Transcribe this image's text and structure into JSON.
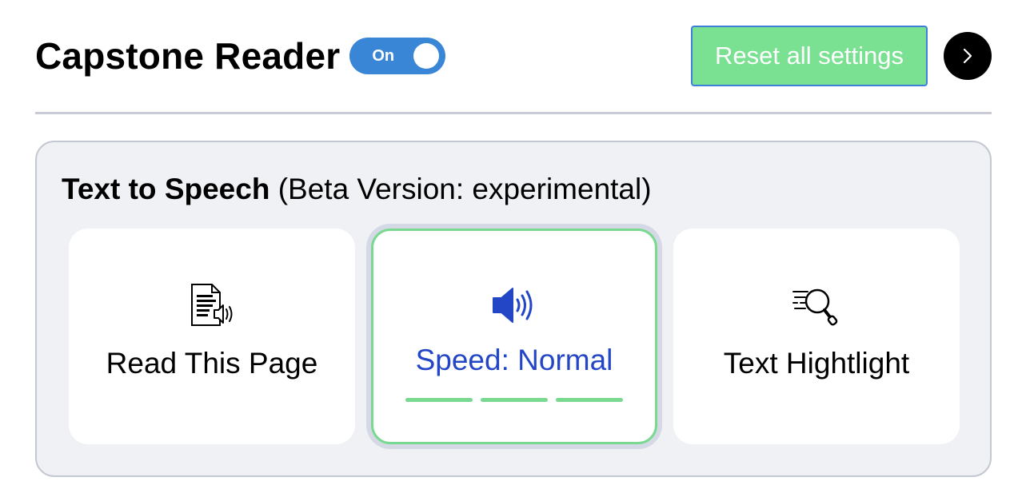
{
  "header": {
    "title": "Capstone Reader",
    "toggle_label": "On",
    "reset_label": "Reset all settings",
    "next_icon": "chevron-right-icon"
  },
  "panel": {
    "title_bold": "Text to Speech",
    "title_rest": " (Beta Version: experimental)",
    "cards": [
      {
        "label": "Read This Page",
        "icon": "document-audio-icon"
      },
      {
        "label": "Speed: Normal",
        "icon": "speaker-icon",
        "speed_level": 3,
        "speed_levels": 3
      },
      {
        "label": "Text Hightlight",
        "icon": "text-search-icon"
      }
    ]
  },
  "colors": {
    "toggle_on": "#3a86d6",
    "reset_bg": "#7ae092",
    "reset_border": "#3d7fd8",
    "active_accent": "#79d990",
    "active_text": "#2346c6",
    "panel_bg": "#f0f1f5"
  }
}
